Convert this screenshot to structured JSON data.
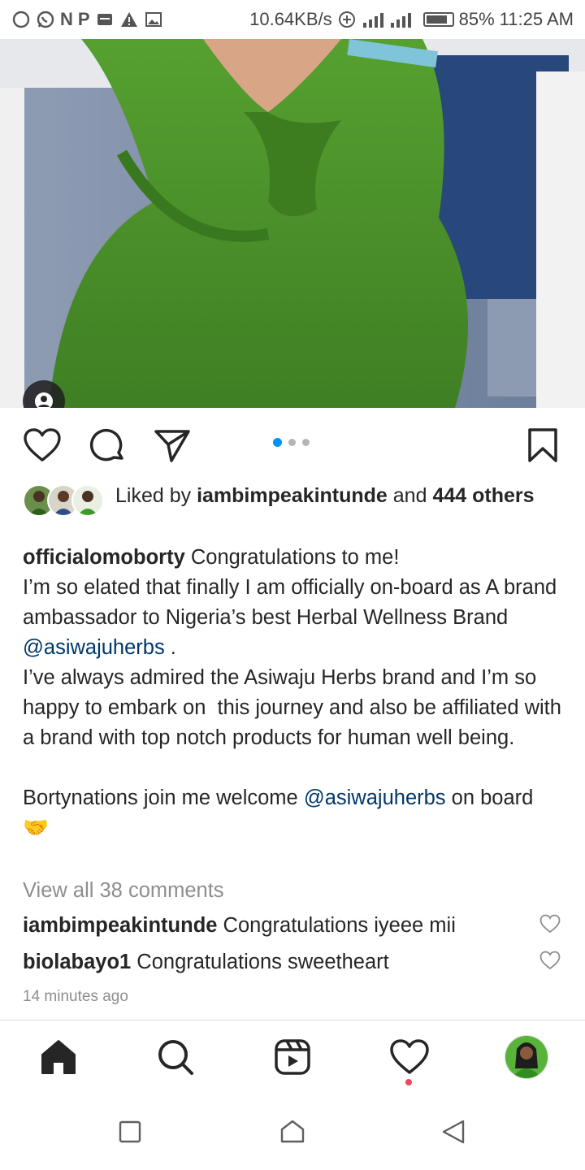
{
  "status_bar": {
    "letters": [
      "N",
      "P"
    ],
    "network_speed": "10.64KB/s",
    "battery": "85%",
    "battery_level": 0.85,
    "time": "11:25 AM"
  },
  "post": {
    "carousel": {
      "total": 3,
      "current": 1
    },
    "liked_by": {
      "prefix": "Liked by ",
      "user": "iambimpeakintunde",
      "middle": " and ",
      "count": "444",
      "suffix": " others"
    },
    "caption": {
      "username": "officialomoborty",
      "line1": " Congratulations to me!",
      "line2": "I’m so elated that finally I am officially on-board as A brand ambassador to Nigeria’s best Herbal Wellness Brand ",
      "mention1": "@asiwajuherbs",
      "after_mention1": " .",
      "line3": "I’ve always admired the Asiwaju Herbs brand and I’m so happy to embark on  this journey and also be affiliated with a brand with top notch products for human well being.",
      "line4_prefix": "Bortynations join me welcome ",
      "mention2": "@asiwajuherbs",
      "line4_suffix": " on board ",
      "emoji": "🤝"
    },
    "view_all_comments": "View all 38 comments",
    "comments": [
      {
        "username": "iambimpeakintunde",
        "text": " Congratulations iyeee mii"
      },
      {
        "username": "biolabayo1",
        "text": " Congratulations sweetheart"
      }
    ],
    "time_ago": "14 minutes ago"
  },
  "icons": {
    "status": [
      "chat-bubble-icon",
      "whatsapp-icon",
      "message-icon",
      "warning-icon",
      "image-icon",
      "add-circle-icon",
      "signal-icon",
      "battery-icon"
    ],
    "actions": [
      "heart-icon",
      "comment-icon",
      "share-icon",
      "bookmark-icon"
    ],
    "nav": [
      "home-icon",
      "search-icon",
      "reels-icon",
      "activity-heart-icon",
      "profile-avatar"
    ],
    "system": [
      "recents-square-icon",
      "home-pentagon-icon",
      "back-triangle-icon"
    ]
  },
  "colors": {
    "link": "#00376b",
    "secondary_text": "#8e8e8e",
    "active_dot": "#0095f6",
    "notification": "#ed4956",
    "dress_green": "#4a8f2c"
  }
}
